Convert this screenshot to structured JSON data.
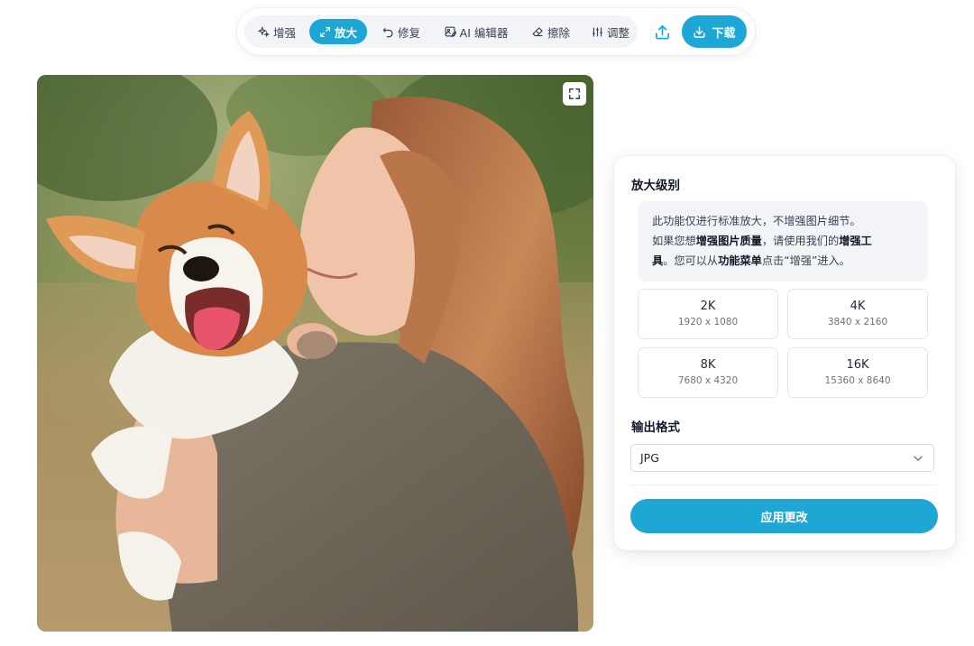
{
  "toolbar": {
    "tools": [
      {
        "label": "增强",
        "icon": "sparkle-icon"
      },
      {
        "label": "放大",
        "icon": "expand-arrows-icon",
        "active": true
      },
      {
        "label": "修复",
        "icon": "undo-icon"
      },
      {
        "label": "AI 编辑器",
        "icon": "image-edit-icon"
      },
      {
        "label": "擦除",
        "icon": "eraser-icon"
      },
      {
        "label": "调整",
        "icon": "sliders-icon"
      }
    ],
    "upload_icon": "upload-icon",
    "download_label": "下载",
    "download_icon": "download-icon"
  },
  "photo": {
    "fullscreen_icon": "fullscreen-icon"
  },
  "panel": {
    "zoom_title": "放大级别",
    "info": {
      "line1": "此功能仅进行标准放大，不增强图片细节。",
      "line2_pre": "如果您想",
      "line2_bold1": "增强图片质量",
      "line2_mid": "，请使用我们的",
      "line2_bold2": "增强工",
      "line3_bold": "具",
      "line3_mid": "。您可以从",
      "line3_bold2": "功能菜单",
      "line3_post": "点击“增强”进入。"
    },
    "resolutions": [
      {
        "label": "2K",
        "size": "1920 x 1080"
      },
      {
        "label": "4K",
        "size": "3840 x 2160"
      },
      {
        "label": "8K",
        "size": "7680 x 4320"
      },
      {
        "label": "16K",
        "size": "15360 x 8640"
      }
    ],
    "format_title": "输出格式",
    "format_value": "JPG",
    "apply_label": "应用更改"
  },
  "colors": {
    "accent": "#1ea7d5",
    "tool_group_bg": "#f2f4f7",
    "card_border": "#e3e6ea"
  }
}
